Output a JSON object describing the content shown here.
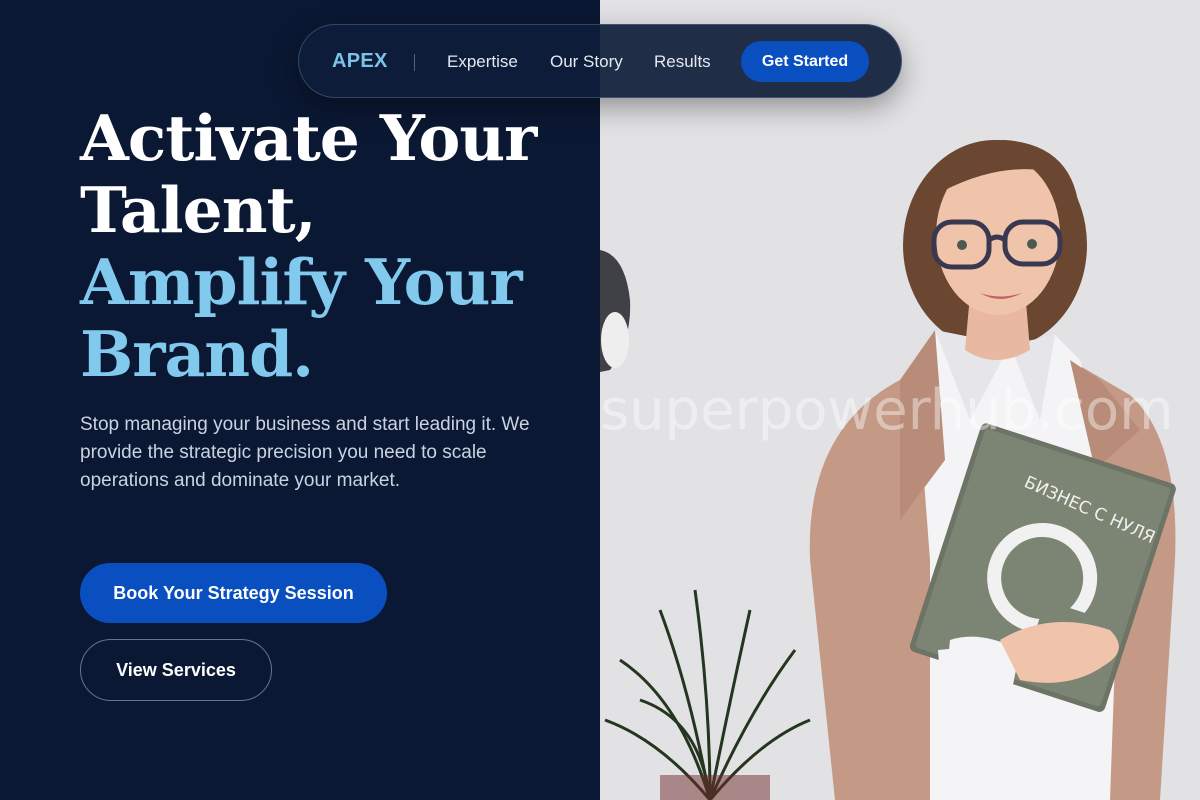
{
  "nav": {
    "logo": "APEX",
    "links": [
      "Expertise",
      "Our Story",
      "Results"
    ],
    "cta": "Get Started"
  },
  "hero": {
    "headline_white": [
      "Activate Your",
      "Talent,"
    ],
    "headline_blue": [
      "Amplify Your",
      "Brand."
    ],
    "subtext": "Stop managing your business and start leading it. We provide the strategic precision you need to scale operations and dominate your market.",
    "primary_button": "Book Your Strategy Session",
    "secondary_button": "View Services"
  },
  "image": {
    "watermark": "superpowerhub.com",
    "book_title": "БИЗНЕС С НУЛЯ"
  },
  "colors": {
    "background": "#0b1833",
    "accent": "#0a4fc0",
    "highlight": "#82c9ee"
  }
}
